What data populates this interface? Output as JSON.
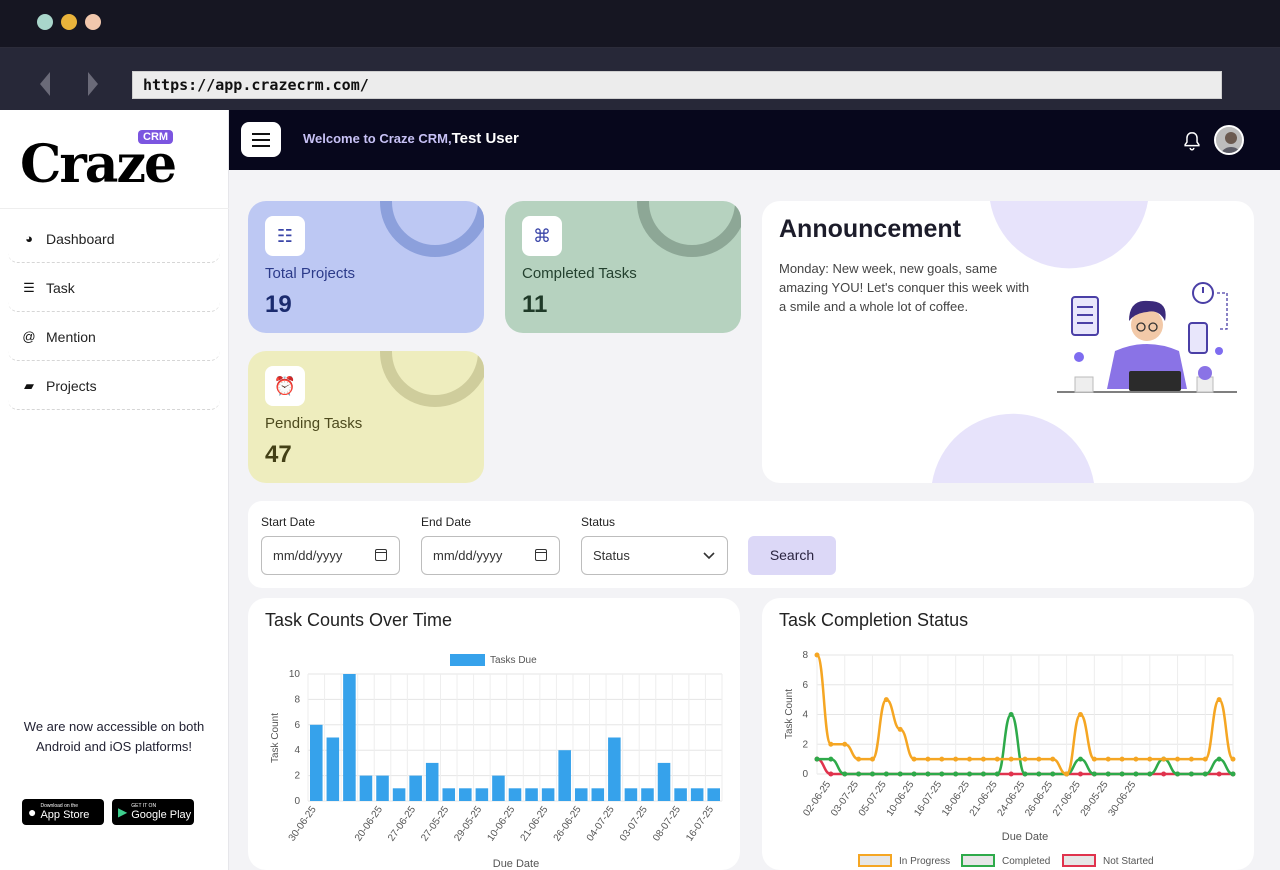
{
  "browser": {
    "url": "https://app.crazecrm.com/"
  },
  "brand": {
    "name": "Craze",
    "badge": "CRM"
  },
  "sidebar": {
    "items": [
      {
        "label": "Dashboard",
        "icon": "dashboard-icon"
      },
      {
        "label": "Task",
        "icon": "task-list-icon"
      },
      {
        "label": "Mention",
        "icon": "at-icon"
      },
      {
        "label": "Projects",
        "icon": "folder-icon"
      }
    ],
    "promo": "We are now accessible on both Android and iOS platforms!",
    "stores": [
      {
        "small": "Download on the",
        "big": "App Store"
      },
      {
        "small": "GET IT ON",
        "big": "Google Play"
      }
    ]
  },
  "header": {
    "welcome": "Welcome to Craze CRM,",
    "user": "Test User"
  },
  "stats": [
    {
      "label": "Total Projects",
      "value": "19",
      "color": "#bdc8f3"
    },
    {
      "label": "Completed Tasks",
      "value": "11",
      "color": "#b6d2bf"
    },
    {
      "label": "Pending Tasks",
      "value": "47",
      "color": "#eeedbe"
    }
  ],
  "announcement": {
    "title": "Announcement",
    "text": "Monday: New week, new goals, same amazing YOU! Let's conquer this week with a smile and a whole lot of coffee."
  },
  "filters": {
    "start_label": "Start Date",
    "start_placeholder": "mm/dd/yyyy",
    "end_label": "End Date",
    "end_placeholder": "mm/dd/yyyy",
    "status_label": "Status",
    "status_value": "Status",
    "search_label": "Search"
  },
  "chart_data": [
    {
      "type": "bar",
      "title": "Task Counts Over Time",
      "xlabel": "Due Date",
      "ylabel": "Task Count",
      "ylim": [
        0,
        10
      ],
      "yticks": [
        "0",
        "2",
        "4",
        "6",
        "8",
        "10"
      ],
      "legend": "Tasks Due",
      "color": "#36a2eb",
      "values": [
        6,
        5,
        10,
        2,
        2,
        1,
        2,
        3,
        1,
        1,
        1,
        2,
        1,
        1,
        1,
        4,
        1,
        1,
        5,
        1,
        1,
        3,
        1,
        1,
        1
      ],
      "xtick_labels": [
        {
          "i": 0,
          "label": "30-06-25"
        },
        {
          "i": 4,
          "label": "20-06-25"
        },
        {
          "i": 6,
          "label": "27-06-25"
        },
        {
          "i": 8,
          "label": "27-05-25"
        },
        {
          "i": 10,
          "label": "29-05-25"
        },
        {
          "i": 12,
          "label": "10-06-25"
        },
        {
          "i": 14,
          "label": "21-06-25"
        },
        {
          "i": 16,
          "label": "26-06-25"
        },
        {
          "i": 18,
          "label": "04-07-25"
        },
        {
          "i": 20,
          "label": "03-07-25"
        },
        {
          "i": 22,
          "label": "08-07-25"
        },
        {
          "i": 24,
          "label": "16-07-25"
        }
      ]
    },
    {
      "type": "line",
      "title": "Task Completion Status",
      "xlabel": "Due Date",
      "ylabel": "Task Count",
      "ylim": [
        0,
        8
      ],
      "yticks": [
        "0",
        "2",
        "4",
        "6",
        "8"
      ],
      "xtick_labels": [
        {
          "i": 1,
          "label": "02-06-25"
        },
        {
          "i": 3,
          "label": "03-07-25"
        },
        {
          "i": 5,
          "label": "05-07-25"
        },
        {
          "i": 7,
          "label": "10-06-25"
        },
        {
          "i": 9,
          "label": "16-07-25"
        },
        {
          "i": 11,
          "label": "18-06-25"
        },
        {
          "i": 13,
          "label": "21-06-25"
        },
        {
          "i": 15,
          "label": "24-06-25"
        },
        {
          "i": 17,
          "label": "26-06-25"
        },
        {
          "i": 19,
          "label": "27-06-25"
        },
        {
          "i": 21,
          "label": "29-05-25"
        },
        {
          "i": 23,
          "label": "30-06-25"
        }
      ],
      "series": [
        {
          "name": "In Progress",
          "color": "#f5a623",
          "values": [
            8,
            2,
            2,
            1,
            1,
            5,
            3,
            1,
            1,
            1,
            1,
            1,
            1,
            1,
            1,
            1,
            1,
            1,
            0,
            4,
            1,
            1,
            1,
            1,
            1,
            1,
            1,
            1,
            1,
            5,
            1
          ]
        },
        {
          "name": "Completed",
          "color": "#2eaa4a",
          "values": [
            1,
            1,
            0,
            0,
            0,
            0,
            0,
            0,
            0,
            0,
            0,
            0,
            0,
            0,
            4,
            0,
            0,
            0,
            0,
            1,
            0,
            0,
            0,
            0,
            0,
            1,
            0,
            0,
            0,
            1,
            0
          ]
        },
        {
          "name": "Not Started",
          "color": "#e0334d",
          "values": [
            1,
            0,
            0,
            0,
            0,
            0,
            0,
            0,
            0,
            0,
            0,
            0,
            0,
            0,
            0,
            0,
            0,
            0,
            0,
            0,
            0,
            0,
            0,
            0,
            0,
            0,
            0,
            0,
            0,
            0,
            0
          ]
        }
      ]
    }
  ]
}
